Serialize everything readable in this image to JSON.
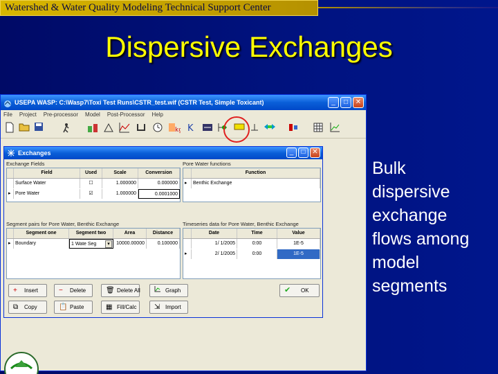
{
  "banner": "Watershed & Water Quality Modeling Technical Support Center",
  "slide_title": "Dispersive Exchanges",
  "bullet_lines": [
    "Bulk",
    "dispersive",
    "exchange",
    "flows among",
    "model",
    "segments"
  ],
  "app": {
    "title": "USEPA WASP: C:\\Wasp7\\Toxi Test Runs\\CSTR_test.wif (CSTR Test, Simple Toxicant)",
    "menu": [
      "File",
      "Project",
      "Pre-processor",
      "Model",
      "Post-Processor",
      "Help"
    ]
  },
  "exchanges": {
    "title": "Exchanges",
    "fields_label": "Exchange Fields",
    "fields_headers": [
      "Field",
      "Used",
      "Scale",
      "Conversion"
    ],
    "fields_rows": [
      {
        "marker": "",
        "field": "Surface Water",
        "used": "☐",
        "scale": "1.000000",
        "conversion": "0.000000"
      },
      {
        "marker": "▸",
        "field": "Pore Water",
        "used": "☑",
        "scale": "1.000000",
        "conversion": "0.0001000"
      }
    ],
    "functions_label": "Pore Water functions",
    "functions_header": "Function",
    "functions_rows": [
      {
        "marker": "▸",
        "value": "Benthic Exchange"
      }
    ],
    "segpairs_label": "Segment pairs for Pore Water, Benthic Exchange",
    "segpairs_headers": [
      "Segment one",
      "Segment two",
      "Area",
      "Distance"
    ],
    "segpairs_rows": [
      {
        "marker": "▸",
        "one": "Boundary",
        "two": "1 Wate Seg",
        "area": "10000.00000",
        "distance": "0.100000"
      }
    ],
    "series_label": "Timeseries data for Pore Water, Benthic Exchange",
    "series_headers": [
      "Date",
      "Time",
      "Value"
    ],
    "series_rows": [
      {
        "marker": "",
        "date": "1/ 1/2005",
        "time": "0:00",
        "value": "1E-5"
      },
      {
        "marker": "▸",
        "date": "2/ 1/2005",
        "time": "0:00",
        "value": "1E-5"
      }
    ],
    "buttons": {
      "insert": "Insert",
      "delete": "Delete",
      "delete_all": "Delete All",
      "graph": "Graph",
      "copy": "Copy",
      "paste": "Paste",
      "fill_calc": "Fill/Calc",
      "import": "Import",
      "ok": "OK"
    }
  },
  "icons": {
    "accent_red": "#e02020",
    "titlebar_blue": "#0a5fd8",
    "banner_gold": "#d9b700",
    "title_yellow": "#ffff00"
  }
}
